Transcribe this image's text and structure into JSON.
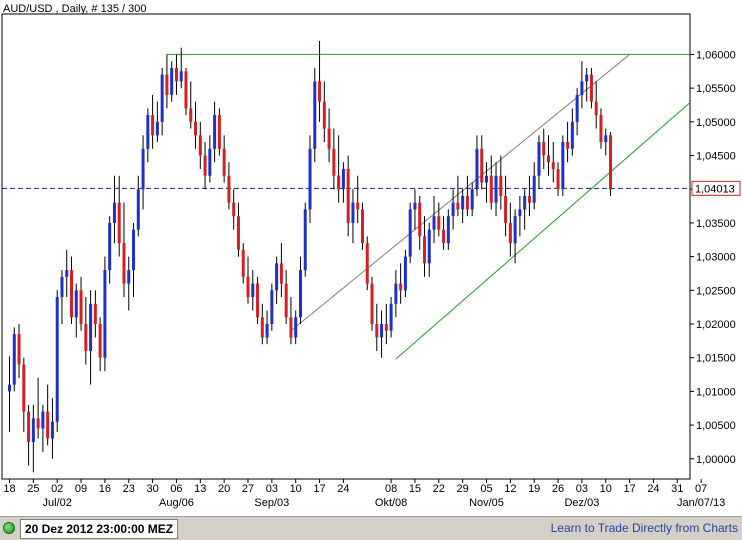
{
  "chart_data": {
    "type": "candlestick",
    "title": "AUD/USD , Daily, # 135 / 300",
    "ylim": [
      0.997,
      1.066
    ],
    "y_ticks": [
      1.0,
      1.005,
      1.01,
      1.015,
      1.02,
      1.025,
      1.03,
      1.035,
      1.04,
      1.045,
      1.05,
      1.055,
      1.06
    ],
    "y_tick_labels": [
      "1,00000",
      "1,00500",
      "1,01000",
      "1,01500",
      "1,02000",
      "1,02500",
      "1,03000",
      "1,03500",
      "1,04000",
      "1,04500",
      "1,05000",
      "1,05500",
      "1,06000"
    ],
    "x_tick_labels": [
      "18",
      "25",
      "02",
      "09",
      "16",
      "23",
      "30",
      "06",
      "13",
      "20",
      "27",
      "03",
      "10",
      "17",
      "24",
      "08",
      "15",
      "22",
      "29",
      "05",
      "12",
      "19",
      "26",
      "03",
      "10",
      "17",
      "24",
      "31",
      "07"
    ],
    "x_tick_bars": [
      0,
      5,
      10,
      15,
      20,
      25,
      30,
      35,
      40,
      45,
      50,
      55,
      60,
      65,
      70,
      80,
      85,
      90,
      95,
      100,
      105,
      110,
      115,
      120,
      125,
      130,
      135,
      140,
      145
    ],
    "month_labels": [
      {
        "label": "Jul/02",
        "bar": 10
      },
      {
        "label": "Aug/06",
        "bar": 35
      },
      {
        "label": "Sep/03",
        "bar": 55
      },
      {
        "label": "Okt/08",
        "bar": 80
      },
      {
        "label": "Nov/05",
        "bar": 100
      },
      {
        "label": "Dez/03",
        "bar": 120
      },
      {
        "label": "Jan/07/13",
        "bar": 145
      }
    ],
    "current_price": 1.04013,
    "current_price_label": "1,04013",
    "horizontal_level": 1.06,
    "trend_lines": [
      {
        "from_bar": 59,
        "from": 1.019,
        "to_bar": 130,
        "to": 1.06,
        "color": "#808080"
      },
      {
        "from_bar": 81,
        "from": 1.0148,
        "to_bar": 151,
        "to": 1.058,
        "color": "#22a022"
      }
    ],
    "up_color": "#1f2fcc",
    "down_color": "#d42020",
    "candles": [
      [
        0,
        1.01,
        1.0152,
        1.004,
        1.011
      ],
      [
        1,
        1.011,
        1.0195,
        1.01,
        1.0185
      ],
      [
        2,
        1.0185,
        1.02,
        1.012,
        1.014
      ],
      [
        3,
        1.014,
        1.015,
        1.004,
        1.007
      ],
      [
        4,
        1.007,
        1.008,
        0.999,
        1.0025
      ],
      [
        5,
        1.0025,
        1.008,
        0.998,
        1.006
      ],
      [
        6,
        1.006,
        1.012,
        1.003,
        1.0045
      ],
      [
        7,
        1.0045,
        1.008,
        1.001,
        1.007
      ],
      [
        8,
        1.007,
        1.011,
        1.002,
        1.003
      ],
      [
        9,
        1.003,
        1.009,
        1.0,
        1.0055
      ],
      [
        10,
        1.0055,
        1.025,
        1.004,
        1.024
      ],
      [
        11,
        1.024,
        1.028,
        1.02,
        1.027
      ],
      [
        12,
        1.027,
        1.031,
        1.024,
        1.028
      ],
      [
        13,
        1.028,
        1.03,
        1.02,
        1.021
      ],
      [
        14,
        1.021,
        1.026,
        1.018,
        1.025
      ],
      [
        15,
        1.025,
        1.027,
        1.019,
        1.02
      ],
      [
        16,
        1.02,
        1.024,
        1.014,
        1.016
      ],
      [
        17,
        1.016,
        1.025,
        1.011,
        1.023
      ],
      [
        18,
        1.023,
        1.025,
        1.018,
        1.02
      ],
      [
        19,
        1.02,
        1.021,
        1.013,
        1.015
      ],
      [
        20,
        1.015,
        1.03,
        1.013,
        1.028
      ],
      [
        21,
        1.028,
        1.036,
        1.026,
        1.035
      ],
      [
        22,
        1.035,
        1.042,
        1.032,
        1.038
      ],
      [
        23,
        1.038,
        1.042,
        1.03,
        1.032
      ],
      [
        24,
        1.032,
        1.038,
        1.024,
        1.026
      ],
      [
        25,
        1.026,
        1.03,
        1.022,
        1.028
      ],
      [
        26,
        1.028,
        1.035,
        1.024,
        1.034
      ],
      [
        27,
        1.034,
        1.042,
        1.033,
        1.04
      ],
      [
        28,
        1.04,
        1.048,
        1.037,
        1.046
      ],
      [
        29,
        1.046,
        1.052,
        1.044,
        1.051
      ],
      [
        30,
        1.051,
        1.054,
        1.046,
        1.048
      ],
      [
        31,
        1.048,
        1.053,
        1.047,
        1.05
      ],
      [
        32,
        1.05,
        1.058,
        1.048,
        1.057
      ],
      [
        33,
        1.057,
        1.06,
        1.052,
        1.054
      ],
      [
        34,
        1.054,
        1.059,
        1.053,
        1.058
      ],
      [
        35,
        1.058,
        1.06,
        1.054,
        1.056
      ],
      [
        36,
        1.056,
        1.061,
        1.055,
        1.0575
      ],
      [
        37,
        1.0575,
        1.058,
        1.051,
        1.052
      ],
      [
        38,
        1.052,
        1.056,
        1.049,
        1.05
      ],
      [
        39,
        1.05,
        1.053,
        1.046,
        1.048
      ],
      [
        40,
        1.048,
        1.05,
        1.043,
        1.045
      ],
      [
        41,
        1.045,
        1.047,
        1.04,
        1.042
      ],
      [
        42,
        1.042,
        1.048,
        1.041,
        1.046
      ],
      [
        43,
        1.046,
        1.053,
        1.044,
        1.051
      ],
      [
        44,
        1.051,
        1.052,
        1.045,
        1.046
      ],
      [
        45,
        1.046,
        1.048,
        1.041,
        1.042
      ],
      [
        46,
        1.042,
        1.044,
        1.037,
        1.038
      ],
      [
        47,
        1.038,
        1.04,
        1.034,
        1.036
      ],
      [
        48,
        1.036,
        1.038,
        1.03,
        1.031
      ],
      [
        49,
        1.031,
        1.032,
        1.026,
        1.027
      ],
      [
        50,
        1.027,
        1.03,
        1.023,
        1.024
      ],
      [
        51,
        1.024,
        1.028,
        1.022,
        1.026
      ],
      [
        52,
        1.026,
        1.027,
        1.02,
        1.021
      ],
      [
        53,
        1.021,
        1.023,
        1.017,
        1.018
      ],
      [
        54,
        1.018,
        1.022,
        1.017,
        1.02
      ],
      [
        55,
        1.02,
        1.026,
        1.019,
        1.025
      ],
      [
        56,
        1.025,
        1.03,
        1.023,
        1.029
      ],
      [
        57,
        1.029,
        1.032,
        1.024,
        1.026
      ],
      [
        58,
        1.026,
        1.028,
        1.02,
        1.021
      ],
      [
        59,
        1.021,
        1.024,
        1.017,
        1.018
      ],
      [
        60,
        1.018,
        1.022,
        1.017,
        1.021
      ],
      [
        61,
        1.021,
        1.03,
        1.02,
        1.028
      ],
      [
        62,
        1.028,
        1.038,
        1.027,
        1.037
      ],
      [
        63,
        1.037,
        1.048,
        1.035,
        1.046
      ],
      [
        64,
        1.046,
        1.058,
        1.044,
        1.056
      ],
      [
        65,
        1.056,
        1.062,
        1.05,
        1.053
      ],
      [
        66,
        1.053,
        1.056,
        1.047,
        1.049
      ],
      [
        67,
        1.049,
        1.052,
        1.044,
        1.046
      ],
      [
        68,
        1.046,
        1.049,
        1.04,
        1.042
      ],
      [
        69,
        1.042,
        1.048,
        1.038,
        1.04
      ],
      [
        70,
        1.04,
        1.044,
        1.038,
        1.043
      ],
      [
        71,
        1.043,
        1.045,
        1.033,
        1.035
      ],
      [
        72,
        1.035,
        1.04,
        1.032,
        1.038
      ],
      [
        73,
        1.038,
        1.042,
        1.035,
        1.037
      ],
      [
        74,
        1.037,
        1.038,
        1.031,
        1.032
      ],
      [
        75,
        1.032,
        1.033,
        1.025,
        1.026
      ],
      [
        76,
        1.026,
        1.027,
        1.019,
        1.02
      ],
      [
        77,
        1.02,
        1.023,
        1.016,
        1.018
      ],
      [
        78,
        1.018,
        1.022,
        1.015,
        1.02
      ],
      [
        79,
        1.02,
        1.023,
        1.017,
        1.019
      ],
      [
        80,
        1.019,
        1.024,
        1.018,
        1.023
      ],
      [
        81,
        1.023,
        1.028,
        1.021,
        1.026
      ],
      [
        82,
        1.026,
        1.029,
        1.023,
        1.025
      ],
      [
        83,
        1.025,
        1.031,
        1.024,
        1.03
      ],
      [
        84,
        1.03,
        1.038,
        1.029,
        1.037
      ],
      [
        85,
        1.037,
        1.04,
        1.034,
        1.038
      ],
      [
        86,
        1.038,
        1.039,
        1.031,
        1.033
      ],
      [
        87,
        1.033,
        1.036,
        1.027,
        1.029
      ],
      [
        88,
        1.029,
        1.035,
        1.027,
        1.034
      ],
      [
        89,
        1.034,
        1.039,
        1.032,
        1.036
      ],
      [
        90,
        1.036,
        1.038,
        1.033,
        1.034
      ],
      [
        91,
        1.034,
        1.036,
        1.031,
        1.032
      ],
      [
        92,
        1.032,
        1.037,
        1.031,
        1.036
      ],
      [
        93,
        1.036,
        1.04,
        1.034,
        1.038
      ],
      [
        94,
        1.038,
        1.042,
        1.036,
        1.037
      ],
      [
        95,
        1.037,
        1.04,
        1.035,
        1.039
      ],
      [
        96,
        1.039,
        1.042,
        1.036,
        1.037
      ],
      [
        97,
        1.037,
        1.041,
        1.036,
        1.04
      ],
      [
        98,
        1.04,
        1.048,
        1.039,
        1.046
      ],
      [
        99,
        1.046,
        1.048,
        1.04,
        1.041
      ],
      [
        100,
        1.041,
        1.044,
        1.038,
        1.042
      ],
      [
        101,
        1.042,
        1.045,
        1.037,
        1.038
      ],
      [
        102,
        1.038,
        1.044,
        1.036,
        1.042
      ],
      [
        103,
        1.042,
        1.045,
        1.037,
        1.039
      ],
      [
        104,
        1.039,
        1.042,
        1.033,
        1.035
      ],
      [
        105,
        1.035,
        1.038,
        1.03,
        1.032
      ],
      [
        106,
        1.032,
        1.037,
        1.029,
        1.036
      ],
      [
        107,
        1.036,
        1.039,
        1.033,
        1.037
      ],
      [
        108,
        1.037,
        1.04,
        1.034,
        1.039
      ],
      [
        109,
        1.039,
        1.042,
        1.036,
        1.038
      ],
      [
        110,
        1.038,
        1.044,
        1.037,
        1.042
      ],
      [
        111,
        1.042,
        1.048,
        1.04,
        1.047
      ],
      [
        112,
        1.047,
        1.049,
        1.043,
        1.045
      ],
      [
        113,
        1.045,
        1.048,
        1.042,
        1.044
      ],
      [
        114,
        1.044,
        1.047,
        1.041,
        1.043
      ],
      [
        115,
        1.043,
        1.044,
        1.039,
        1.04
      ],
      [
        116,
        1.04,
        1.048,
        1.039,
        1.047
      ],
      [
        117,
        1.047,
        1.05,
        1.044,
        1.046
      ],
      [
        118,
        1.046,
        1.052,
        1.045,
        1.05
      ],
      [
        119,
        1.05,
        1.055,
        1.048,
        1.054
      ],
      [
        120,
        1.054,
        1.059,
        1.052,
        1.056
      ],
      [
        121,
        1.056,
        1.058,
        1.053,
        1.057
      ],
      [
        122,
        1.057,
        1.058,
        1.052,
        1.053
      ],
      [
        123,
        1.053,
        1.056,
        1.049,
        1.051
      ],
      [
        124,
        1.051,
        1.052,
        1.046,
        1.047
      ],
      [
        125,
        1.047,
        1.049,
        1.045,
        1.048
      ],
      [
        126,
        1.048,
        1.0485,
        1.039,
        1.04
      ]
    ]
  },
  "footer": {
    "timestamp": "20 Dez 2012 23:00:00 MEZ",
    "link": "Learn to Trade Directly from Charts"
  }
}
